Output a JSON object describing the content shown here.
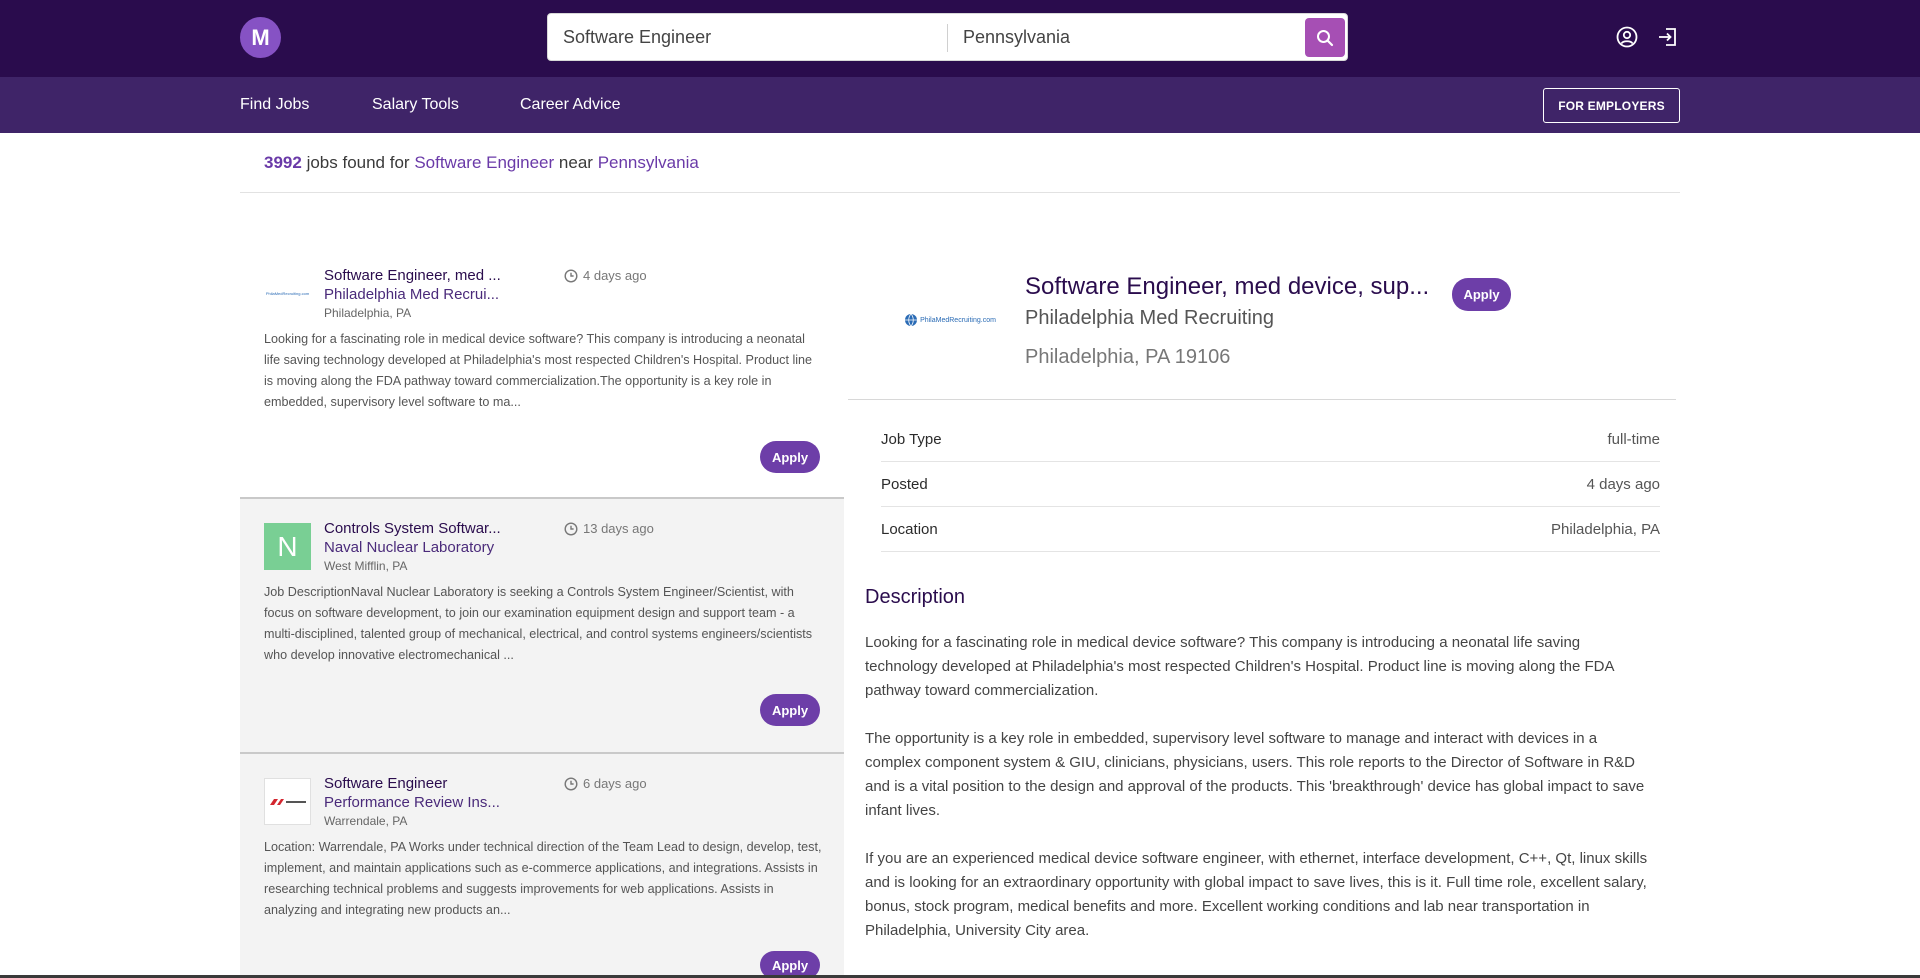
{
  "header": {
    "logo_letter": "M",
    "search_keyword": "Software Engineer",
    "search_location": "Pennsylvania"
  },
  "nav": {
    "find_jobs": "Find Jobs",
    "salary_tools": "Salary Tools",
    "career_advice": "Career Advice",
    "for_employers": "FOR EMPLOYERS"
  },
  "summary": {
    "count": "3992",
    "text1": "jobs found for",
    "keyword": "Software Engineer",
    "text2": "near",
    "location": "Pennsylvania"
  },
  "jobs": [
    {
      "title": "Software Engineer, med ...",
      "company": "Philadelphia Med Recrui...",
      "location": "Philadelphia, PA",
      "age": "4 days ago",
      "description": "Looking for a fascinating role in medical device software? This company is introducing a neonatal life saving technology developed at Philadelphia's most respected Children's Hospital. Product line is moving along the FDA pathway toward commercialization.The opportunity is a key role in embedded, supervisory level software to ma...",
      "apply": "Apply",
      "logo_text": "PhilaMedRecruiting.com"
    },
    {
      "title": "Controls System Softwar...",
      "company": "Naval Nuclear Laboratory",
      "location": "West Mifflin, PA",
      "age": "13 days ago",
      "description": "Job DescriptionNaval Nuclear Laboratory is seeking a Controls System Engineer/Scientist, with focus on software development, to join our examination equipment design and support team - a multi-disciplined, talented group of mechanical, electrical, and control systems engineers/scientists who develop innovative electromechanical ...",
      "apply": "Apply",
      "logo_letter": "N"
    },
    {
      "title": "Software Engineer",
      "company": "Performance Review Ins...",
      "location": "Warrendale, PA",
      "age": "6 days ago",
      "description": "Location: Warrendale, PA Works under technical direction of the Team Lead to design, develop, test, implement, and maintain applications such as e-commerce applications, and integrations. Assists in researching technical problems and suggests improvements for web applications. Assists in analyzing and integrating new products an...",
      "apply": "Apply"
    }
  ],
  "detail": {
    "title": "Software Engineer, med device, sup...",
    "apply": "Apply",
    "company": "Philadelphia Med Recruiting",
    "location": "Philadelphia, PA 19106",
    "logo_text": "PhilaMedRecruiting.com",
    "info": [
      {
        "key": "Job Type",
        "value": "full-time"
      },
      {
        "key": "Posted",
        "value": "4 days ago"
      },
      {
        "key": "Location",
        "value": "Philadelphia, PA"
      }
    ],
    "description_heading": "Description",
    "paragraphs": [
      "Looking for a fascinating role in medical device software? This company is introducing a neonatal life saving technology developed at Philadelphia's most respected Children's Hospital. Product line is moving along the FDA pathway toward commercialization.",
      "The opportunity is a key role in embedded, supervisory level software to manage and interact with devices in a complex component system & GIU, clinicians, physicians, users. This role reports to the Director of Software in R&D and is a vital position to the design and approval of the products. This 'breakthrough' device has global impact to save infant lives.",
      "If you are an experienced medical device software engineer, with ethernet, interface development, C++, Qt, linux skills and is looking for an extraordinary opportunity with global impact to save lives, this is it. Full time role, excellent salary, bonus, stock program, medical benefits and more. Excellent working conditions and lab near transportation in Philadelphia, University City area."
    ]
  },
  "colors": {
    "topbar": "#2a0c4d",
    "navbar": "#3f2468",
    "accent": "#6d3ea8",
    "search_button": "#a64fb4"
  }
}
